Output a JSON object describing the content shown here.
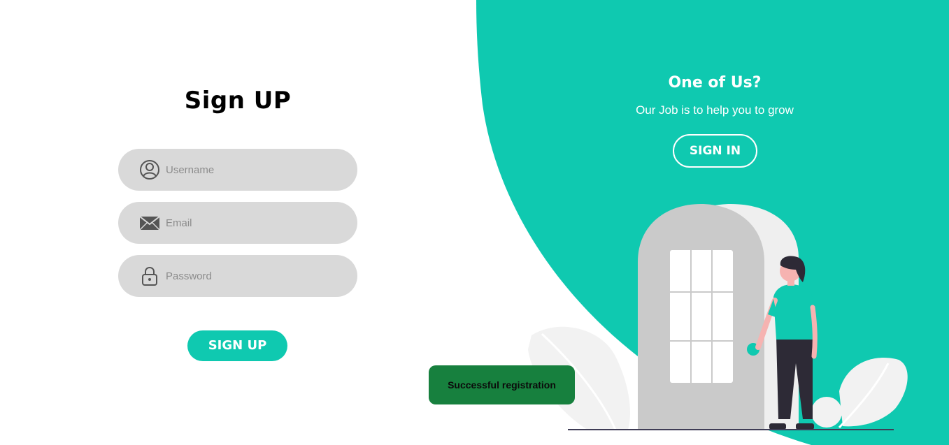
{
  "colors": {
    "accent": "#0fc9b0",
    "field_bg": "#d9d9d9",
    "toast_bg": "#17803e",
    "text_dark": "#000000"
  },
  "signup_form": {
    "title": "Sign UP",
    "username": {
      "placeholder": "Username",
      "value": "",
      "icon": "user-icon"
    },
    "email": {
      "placeholder": "Email",
      "value": "",
      "icon": "mail-icon"
    },
    "password": {
      "placeholder": "Password",
      "value": "",
      "icon": "lock-icon"
    },
    "submit_label": "SIGN UP"
  },
  "toast": {
    "message": "Successful registration"
  },
  "signin_panel": {
    "title": "One of Us?",
    "subtitle": "Our Job is to help you to grow",
    "button_label": "SIGN IN"
  }
}
